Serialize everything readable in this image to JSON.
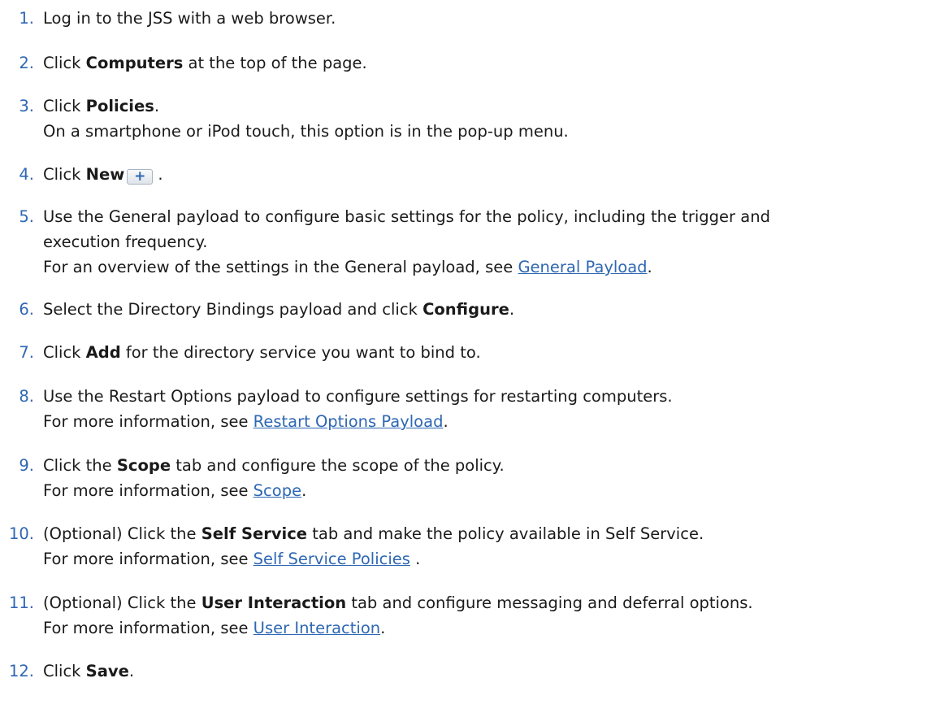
{
  "steps": [
    {
      "num": "1.",
      "a": "Log in to the JSS with a web browser."
    },
    {
      "num": "2.",
      "a": "Click ",
      "b": "Computers",
      "c": " at the top of the page."
    },
    {
      "num": "3.",
      "a": "Click ",
      "b": "Policies",
      "c": ".",
      "note": "On a smartphone or iPod touch, this option is in the pop-up menu."
    },
    {
      "num": "4.",
      "a": "Click ",
      "b": "New",
      "icon": "+",
      "c": " ."
    },
    {
      "num": "5.",
      "a": "Use the General payload to configure basic settings for the policy, including the trigger and",
      "a2": "execution frequency.",
      "note": "For an overview of the settings in the General payload, see ",
      "link": "General Payload",
      "end": "."
    },
    {
      "num": "6.",
      "a": "Select the Directory Bindings payload and click ",
      "b": "Configure",
      "c": "."
    },
    {
      "num": "7.",
      "a": "Click ",
      "b": "Add",
      "c": " for the directory service you want to bind to."
    },
    {
      "num": "8.",
      "a": "Use the Restart Options payload to configure settings for restarting computers.",
      "note": "For more information, see ",
      "link": "Restart Options Payload",
      "end": "."
    },
    {
      "num": "9.",
      "a": "Click the ",
      "b": "Scope",
      "c": " tab and configure the scope of the policy.",
      "note": "For more information, see ",
      "link": "Scope",
      "end": "."
    },
    {
      "num": "10.",
      "a": "(Optional) Click the ",
      "b": "Self Service",
      "c": " tab and make the policy available in Self Service.",
      "note": "For more information, see ",
      "link": "Self Service Policies",
      "end": " ."
    },
    {
      "num": "11.",
      "a": "(Optional) Click the ",
      "b": "User Interaction",
      "c": " tab and configure messaging and deferral options.",
      "note": "For more information, see ",
      "link": "User Interaction",
      "end": "."
    },
    {
      "num": "12.",
      "a": "Click ",
      "b": "Save",
      "c": "."
    }
  ]
}
